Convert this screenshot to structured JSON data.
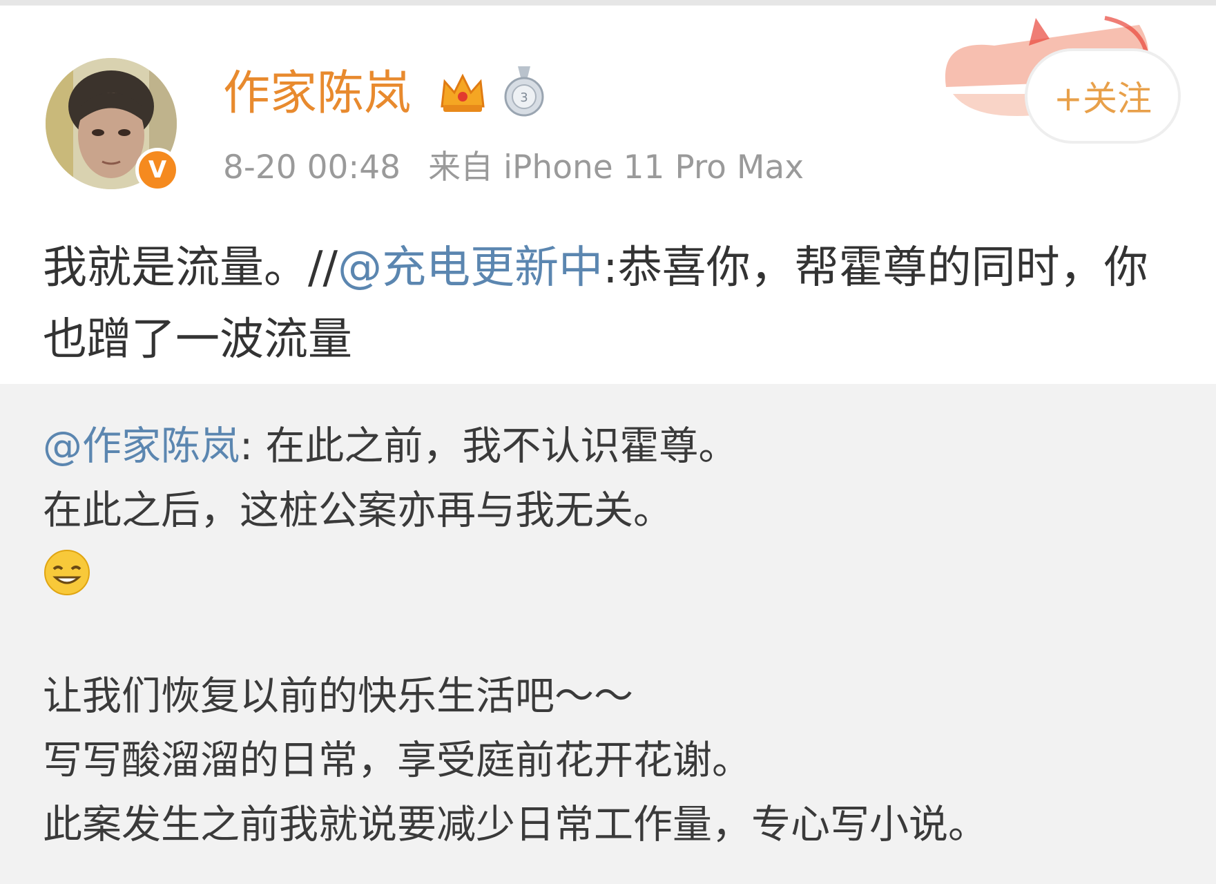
{
  "post": {
    "author": "作家陈岚",
    "date": "8-20 00:48",
    "source": "来自 iPhone 11 Pro Max",
    "follow_label": "+关注",
    "text_main": "我就是流量。//",
    "mention": "@充电更新中",
    "text_after_mention": ":恭喜你，帮霍尊的同时，你也蹭了一波流量"
  },
  "quoted": {
    "mention": "@作家陈岚",
    "line1": ": 在此之前，我不认识霍尊。",
    "line2": "在此之后，这桩公案亦再与我无关。",
    "para_line1": "让我们恢复以前的快乐生活吧～～",
    "para_line2": "写写酸溜溜的日常，享受庭前花开花谢。",
    "para_line3": "此案发生之前我就说要减少日常工作量，专心写小说。"
  },
  "colors": {
    "username": "#e88a2e",
    "mention": "#5b86b0",
    "verified": "#f58a1f",
    "quoted_background": "#f2f2f2"
  },
  "icons": [
    "crown-icon",
    "medal-icon",
    "verified-badge-icon",
    "emoji-icon",
    "avatar"
  ]
}
